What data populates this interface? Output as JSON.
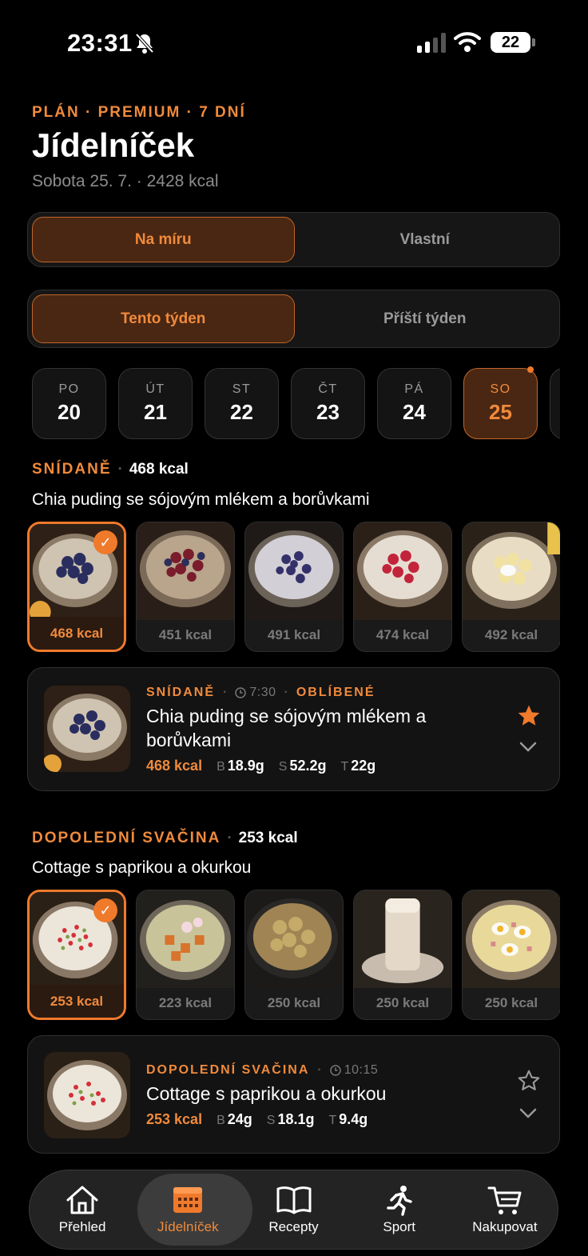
{
  "status": {
    "time": "23:31",
    "battery": "22"
  },
  "header": {
    "eyebrow": "PLÁN · PREMIUM · 7 DNÍ",
    "title": "Jídelníček",
    "subtitle": "Sobota 25. 7. · 2428 kcal"
  },
  "plan_toggle": {
    "options": [
      "Na míru",
      "Vlastní"
    ],
    "selected": "Na míru"
  },
  "week_toggle": {
    "options": [
      "Tento týden",
      "Příští týden"
    ],
    "selected": "Tento týden"
  },
  "days": [
    {
      "name": "PO",
      "date": "20"
    },
    {
      "name": "ÚT",
      "date": "21"
    },
    {
      "name": "ST",
      "date": "22"
    },
    {
      "name": "ČT",
      "date": "23"
    },
    {
      "name": "PÁ",
      "date": "24"
    },
    {
      "name": "SO",
      "date": "25",
      "active": true
    }
  ],
  "meals": [
    {
      "label": "SNÍDANĚ",
      "kcal": "468 kcal",
      "dish": "Chia puding se sójovým mlékem a borůvkami",
      "options": [
        "468 kcal",
        "451 kcal",
        "491 kcal",
        "474 kcal",
        "492 kcal"
      ],
      "card": {
        "label": "SNÍDANĚ",
        "time": "7:30",
        "tag": "OBLÍBENÉ",
        "name": "Chia puding se sójovým mlékem a borůvkami",
        "kcal": "468 kcal",
        "b_label": "B",
        "b": "18.9g",
        "s_label": "S",
        "s": "52.2g",
        "t_label": "T",
        "t": "22g",
        "favorite": true
      }
    },
    {
      "label": "DOPOLEDNÍ SVAČINA",
      "kcal": "253 kcal",
      "dish": "Cottage s paprikou a okurkou",
      "options": [
        "253 kcal",
        "223 kcal",
        "250 kcal",
        "250 kcal",
        "250 kcal"
      ],
      "card": {
        "label": "DOPOLEDNÍ SVAČINA",
        "time": "10:15",
        "name": "Cottage s paprikou a okurkou",
        "kcal": "253 kcal",
        "b_label": "B",
        "b": "24g",
        "s_label": "S",
        "s": "18.1g",
        "t_label": "T",
        "t": "9.4g",
        "favorite": false
      }
    }
  ],
  "tabs": [
    {
      "label": "Přehled",
      "icon": "home-icon"
    },
    {
      "label": "Jídelníček",
      "icon": "calendar-icon",
      "active": true
    },
    {
      "label": "Recepty",
      "icon": "book-icon"
    },
    {
      "label": "Sport",
      "icon": "running-icon"
    },
    {
      "label": "Nakupovat",
      "icon": "cart-icon"
    }
  ],
  "colors": {
    "accent": "#f08a3c",
    "accent_bg": "#4a2712",
    "background": "#000000"
  }
}
